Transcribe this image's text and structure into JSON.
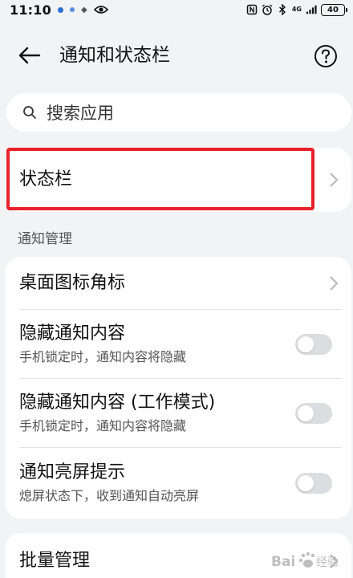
{
  "status_bar": {
    "time": "11:10",
    "network": "4G",
    "battery": "40",
    "icons": [
      "notification-dot-icon",
      "notification-dot-icon",
      "compass-icon",
      "eye-icon",
      "nfc-icon",
      "alarm-icon",
      "bluetooth-icon",
      "signal-icon"
    ]
  },
  "header": {
    "title": "通知和状态栏",
    "back_icon": "back-arrow-icon",
    "help_icon": "question-icon"
  },
  "search": {
    "placeholder": "搜索应用"
  },
  "status_bar_item": {
    "label": "状态栏"
  },
  "section": {
    "label": "通知管理"
  },
  "notification_items": [
    {
      "title": "桌面图标角标",
      "type": "link"
    },
    {
      "title": "隐藏通知内容",
      "subtitle": "手机锁定时，通知内容将隐藏",
      "type": "toggle",
      "on": false
    },
    {
      "title": "隐藏通知内容 (工作模式)",
      "subtitle": "手机锁定时，通知内容将隐藏",
      "type": "toggle",
      "on": false
    },
    {
      "title": "通知亮屏提示",
      "subtitle": "熄屏状态下，收到通知自动亮屏",
      "type": "toggle",
      "on": false
    }
  ],
  "batch": {
    "label": "批量管理"
  },
  "watermark": "Bai 经验",
  "colors": {
    "background": "#f1f3f5",
    "card": "#ffffff",
    "highlight": "#e8202a",
    "toggle_off": "#dcdde0"
  }
}
